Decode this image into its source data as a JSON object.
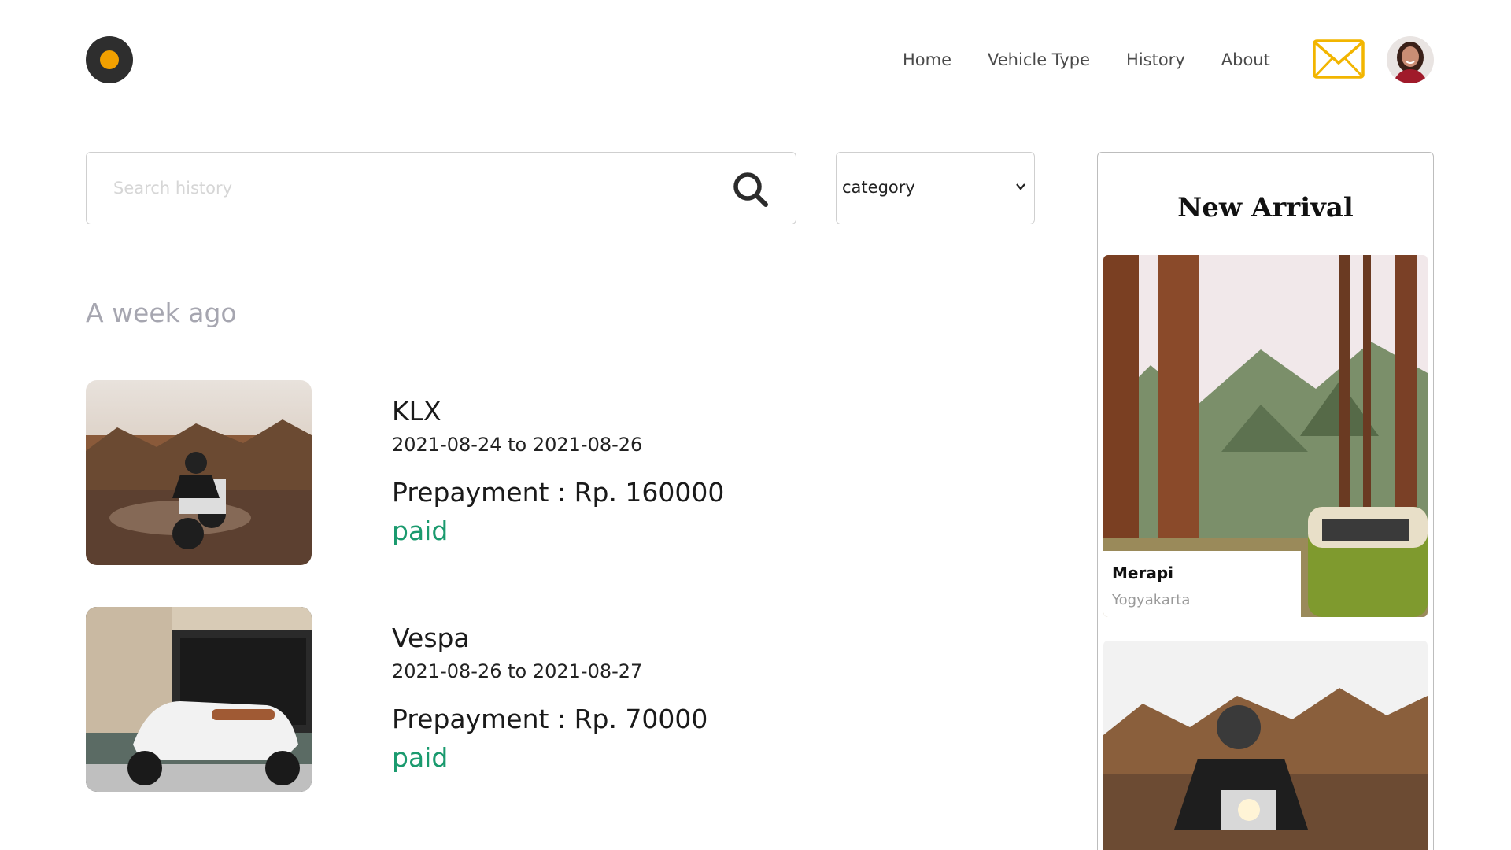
{
  "brand": {
    "accent": "#f2a000",
    "logo_bg": "#2e2e2e"
  },
  "nav": {
    "items": [
      {
        "label": "Home"
      },
      {
        "label": "Vehicle Type"
      },
      {
        "label": "History"
      },
      {
        "label": "About"
      }
    ],
    "mail_icon": "mail-icon",
    "avatar_icon": "user-avatar"
  },
  "search": {
    "placeholder": "Search history",
    "value": ""
  },
  "category": {
    "selected": "category"
  },
  "history": {
    "group_title": "A week ago",
    "items": [
      {
        "name": "KLX",
        "dates": "2021-08-24 to 2021-08-26",
        "prepayment": "Prepayment : Rp. 160000",
        "status": "paid"
      },
      {
        "name": "Vespa",
        "dates": "2021-08-26 to 2021-08-27",
        "prepayment": "Prepayment : Rp. 70000",
        "status": "paid"
      }
    ]
  },
  "new_arrival": {
    "title": "New Arrival",
    "items": [
      {
        "name": "Merapi",
        "location": "Yogyakarta"
      }
    ]
  },
  "colors": {
    "status_paid": "#1a9a6e",
    "mail": "#f2b500"
  }
}
